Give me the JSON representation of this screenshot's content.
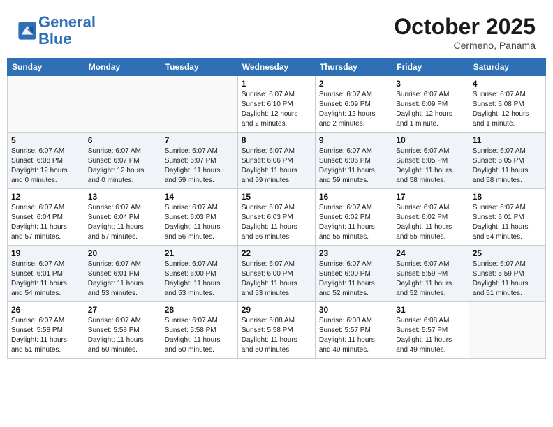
{
  "header": {
    "logo_line1": "General",
    "logo_line2": "Blue",
    "month": "October 2025",
    "location": "Cermeno, Panama"
  },
  "weekdays": [
    "Sunday",
    "Monday",
    "Tuesday",
    "Wednesday",
    "Thursday",
    "Friday",
    "Saturday"
  ],
  "weeks": [
    [
      {
        "day": "",
        "info": ""
      },
      {
        "day": "",
        "info": ""
      },
      {
        "day": "",
        "info": ""
      },
      {
        "day": "1",
        "info": "Sunrise: 6:07 AM\nSunset: 6:10 PM\nDaylight: 12 hours\nand 2 minutes."
      },
      {
        "day": "2",
        "info": "Sunrise: 6:07 AM\nSunset: 6:09 PM\nDaylight: 12 hours\nand 2 minutes."
      },
      {
        "day": "3",
        "info": "Sunrise: 6:07 AM\nSunset: 6:09 PM\nDaylight: 12 hours\nand 1 minute."
      },
      {
        "day": "4",
        "info": "Sunrise: 6:07 AM\nSunset: 6:08 PM\nDaylight: 12 hours\nand 1 minute."
      }
    ],
    [
      {
        "day": "5",
        "info": "Sunrise: 6:07 AM\nSunset: 6:08 PM\nDaylight: 12 hours\nand 0 minutes."
      },
      {
        "day": "6",
        "info": "Sunrise: 6:07 AM\nSunset: 6:07 PM\nDaylight: 12 hours\nand 0 minutes."
      },
      {
        "day": "7",
        "info": "Sunrise: 6:07 AM\nSunset: 6:07 PM\nDaylight: 11 hours\nand 59 minutes."
      },
      {
        "day": "8",
        "info": "Sunrise: 6:07 AM\nSunset: 6:06 PM\nDaylight: 11 hours\nand 59 minutes."
      },
      {
        "day": "9",
        "info": "Sunrise: 6:07 AM\nSunset: 6:06 PM\nDaylight: 11 hours\nand 59 minutes."
      },
      {
        "day": "10",
        "info": "Sunrise: 6:07 AM\nSunset: 6:05 PM\nDaylight: 11 hours\nand 58 minutes."
      },
      {
        "day": "11",
        "info": "Sunrise: 6:07 AM\nSunset: 6:05 PM\nDaylight: 11 hours\nand 58 minutes."
      }
    ],
    [
      {
        "day": "12",
        "info": "Sunrise: 6:07 AM\nSunset: 6:04 PM\nDaylight: 11 hours\nand 57 minutes."
      },
      {
        "day": "13",
        "info": "Sunrise: 6:07 AM\nSunset: 6:04 PM\nDaylight: 11 hours\nand 57 minutes."
      },
      {
        "day": "14",
        "info": "Sunrise: 6:07 AM\nSunset: 6:03 PM\nDaylight: 11 hours\nand 56 minutes."
      },
      {
        "day": "15",
        "info": "Sunrise: 6:07 AM\nSunset: 6:03 PM\nDaylight: 11 hours\nand 56 minutes."
      },
      {
        "day": "16",
        "info": "Sunrise: 6:07 AM\nSunset: 6:02 PM\nDaylight: 11 hours\nand 55 minutes."
      },
      {
        "day": "17",
        "info": "Sunrise: 6:07 AM\nSunset: 6:02 PM\nDaylight: 11 hours\nand 55 minutes."
      },
      {
        "day": "18",
        "info": "Sunrise: 6:07 AM\nSunset: 6:01 PM\nDaylight: 11 hours\nand 54 minutes."
      }
    ],
    [
      {
        "day": "19",
        "info": "Sunrise: 6:07 AM\nSunset: 6:01 PM\nDaylight: 11 hours\nand 54 minutes."
      },
      {
        "day": "20",
        "info": "Sunrise: 6:07 AM\nSunset: 6:01 PM\nDaylight: 11 hours\nand 53 minutes."
      },
      {
        "day": "21",
        "info": "Sunrise: 6:07 AM\nSunset: 6:00 PM\nDaylight: 11 hours\nand 53 minutes."
      },
      {
        "day": "22",
        "info": "Sunrise: 6:07 AM\nSunset: 6:00 PM\nDaylight: 11 hours\nand 53 minutes."
      },
      {
        "day": "23",
        "info": "Sunrise: 6:07 AM\nSunset: 6:00 PM\nDaylight: 11 hours\nand 52 minutes."
      },
      {
        "day": "24",
        "info": "Sunrise: 6:07 AM\nSunset: 5:59 PM\nDaylight: 11 hours\nand 52 minutes."
      },
      {
        "day": "25",
        "info": "Sunrise: 6:07 AM\nSunset: 5:59 PM\nDaylight: 11 hours\nand 51 minutes."
      }
    ],
    [
      {
        "day": "26",
        "info": "Sunrise: 6:07 AM\nSunset: 5:58 PM\nDaylight: 11 hours\nand 51 minutes."
      },
      {
        "day": "27",
        "info": "Sunrise: 6:07 AM\nSunset: 5:58 PM\nDaylight: 11 hours\nand 50 minutes."
      },
      {
        "day": "28",
        "info": "Sunrise: 6:07 AM\nSunset: 5:58 PM\nDaylight: 11 hours\nand 50 minutes."
      },
      {
        "day": "29",
        "info": "Sunrise: 6:08 AM\nSunset: 5:58 PM\nDaylight: 11 hours\nand 50 minutes."
      },
      {
        "day": "30",
        "info": "Sunrise: 6:08 AM\nSunset: 5:57 PM\nDaylight: 11 hours\nand 49 minutes."
      },
      {
        "day": "31",
        "info": "Sunrise: 6:08 AM\nSunset: 5:57 PM\nDaylight: 11 hours\nand 49 minutes."
      },
      {
        "day": "",
        "info": ""
      }
    ]
  ]
}
